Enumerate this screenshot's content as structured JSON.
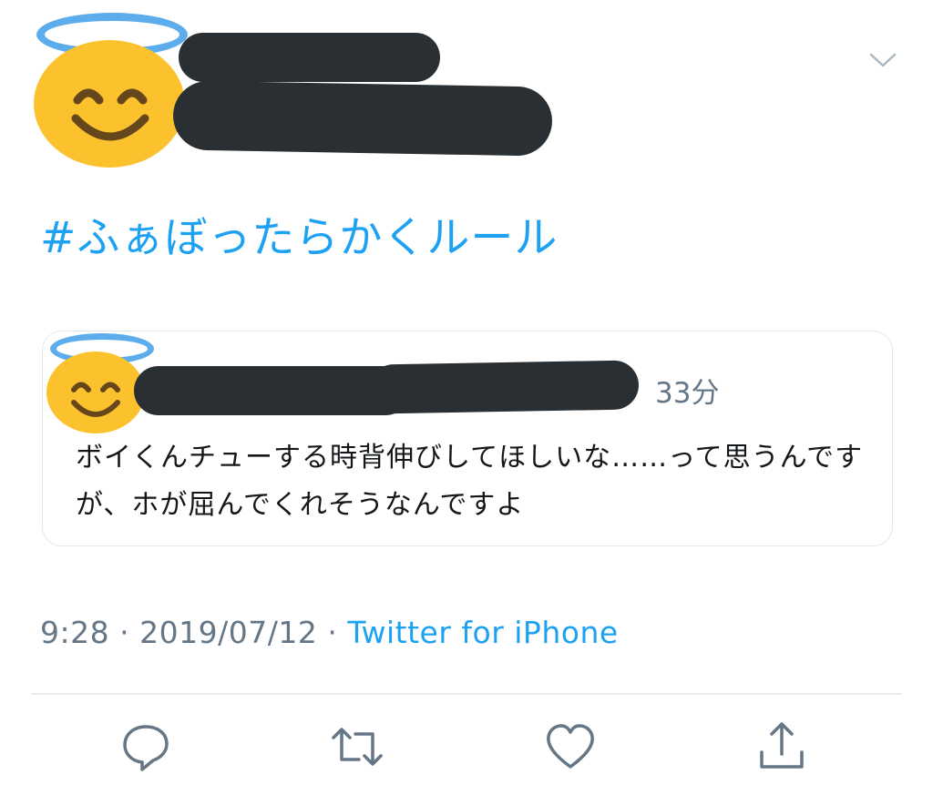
{
  "tweet": {
    "hashtag": "#ふぁぼったらかくルール",
    "time": "9:28",
    "separator": "·",
    "date": "2019/07/12",
    "source": "Twitter for iPhone"
  },
  "quoted": {
    "timestamp": "33分",
    "text": "ボイくんチューする時背伸びしてほしいな……って思うんですが、ホが屈んでくれそうなんですよ"
  },
  "colors": {
    "link": "#1da1f2",
    "muted": "#657786",
    "redaction": "#292f33",
    "emoji_face": "#fcc22d",
    "emoji_halo": "#5dadec"
  },
  "icons": [
    "chevron-down-icon",
    "reply-icon",
    "retweet-icon",
    "like-icon",
    "share-icon"
  ]
}
